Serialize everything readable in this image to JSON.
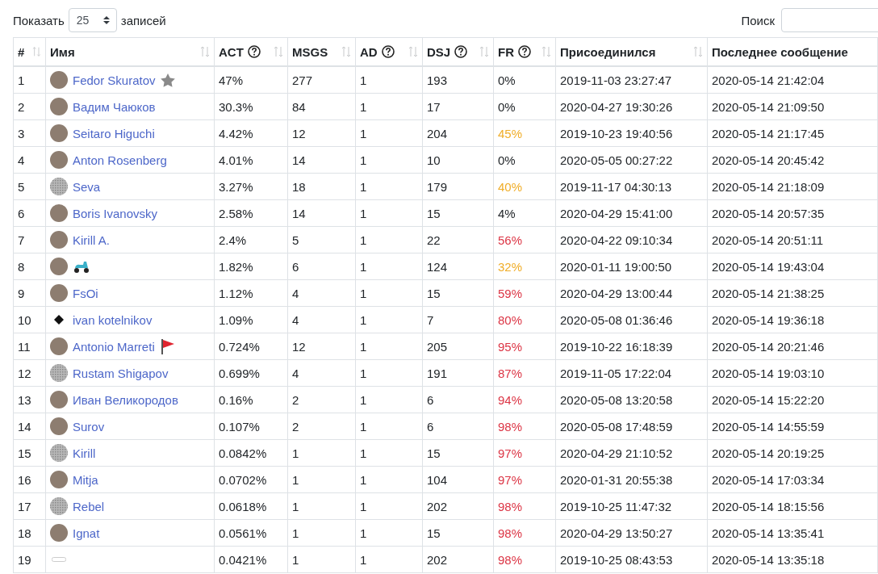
{
  "length_control": {
    "label_before": "Показать",
    "value": "25",
    "label_after": "записей"
  },
  "search": {
    "label": "Поиск"
  },
  "columns": [
    {
      "label": "#",
      "help": false,
      "sortable": true
    },
    {
      "label": "Имя",
      "help": false,
      "sortable": true
    },
    {
      "label": "ACT",
      "help": true,
      "sortable": true
    },
    {
      "label": "MSGS",
      "help": false,
      "sortable": true
    },
    {
      "label": "AD",
      "help": true,
      "sortable": true
    },
    {
      "label": "DSJ",
      "help": true,
      "sortable": true
    },
    {
      "label": "FR",
      "help": true,
      "sortable": true
    },
    {
      "label": "Присоединился",
      "help": false,
      "sortable": true
    },
    {
      "label": "Последнее сообщение",
      "help": false,
      "sortable": false
    }
  ],
  "rows": [
    {
      "num": "1",
      "avatar": {
        "kind": "photo"
      },
      "name": "Fedor Skuratov",
      "badge": {
        "kind": "star"
      },
      "act": "47%",
      "msgs": "277",
      "ad": "1",
      "dsj": "193",
      "fr": "0%",
      "color": "#212529",
      "joined": "2019-11-03 23:27:47",
      "last": "2020-05-14 21:42:04"
    },
    {
      "num": "2",
      "avatar": {
        "kind": "photo"
      },
      "name": "Вадим Чаюков",
      "act": "30.3%",
      "msgs": "84",
      "ad": "1",
      "dsj": "17",
      "fr": "0%",
      "color": "#212529",
      "joined": "2020-04-27 19:30:26",
      "last": "2020-05-14 21:09:50"
    },
    {
      "num": "3",
      "avatar": {
        "kind": "photo"
      },
      "name": "Seitaro Higuchi",
      "act": "4.42%",
      "msgs": "12",
      "ad": "1",
      "dsj": "204",
      "fr": "45%",
      "color": "#f0ad28",
      "joined": "2019-10-23 19:40:56",
      "last": "2020-05-14 21:17:45"
    },
    {
      "num": "4",
      "avatar": {
        "kind": "photo"
      },
      "name": "Anton Rosenberg",
      "act": "4.01%",
      "msgs": "14",
      "ad": "1",
      "dsj": "10",
      "fr": "0%",
      "color": "#212529",
      "joined": "2020-05-05 00:27:22",
      "last": "2020-05-14 20:45:42"
    },
    {
      "num": "5",
      "avatar": {
        "kind": "pattern"
      },
      "name": "Seva",
      "act": "3.27%",
      "msgs": "18",
      "ad": "1",
      "dsj": "179",
      "fr": "40%",
      "color": "#f0ad28",
      "joined": "2019-11-17 04:30:13",
      "last": "2020-05-14 21:18:09"
    },
    {
      "num": "6",
      "avatar": {
        "kind": "photo"
      },
      "name": "Boris Ivanovsky",
      "act": "2.58%",
      "msgs": "14",
      "ad": "1",
      "dsj": "15",
      "fr": "4%",
      "color": "#212529",
      "joined": "2020-04-29 15:41:00",
      "last": "2020-05-14 20:57:35"
    },
    {
      "num": "7",
      "avatar": {
        "kind": "photo"
      },
      "name": "Kirill A.",
      "act": "2.4%",
      "msgs": "5",
      "ad": "1",
      "dsj": "22",
      "fr": "56%",
      "color": "#dc3545",
      "joined": "2020-04-22 09:10:34",
      "last": "2020-05-14 20:51:11"
    },
    {
      "num": "8",
      "avatar": {
        "kind": "photo"
      },
      "badge": {
        "kind": "scooter"
      },
      "act": "1.82%",
      "msgs": "6",
      "ad": "1",
      "dsj": "124",
      "fr": "32%",
      "color": "#f0ad28",
      "joined": "2020-01-11 19:00:50",
      "last": "2020-05-14 19:43:04"
    },
    {
      "num": "9",
      "avatar": {
        "kind": "photo"
      },
      "name": "FsOi",
      "act": "1.12%",
      "msgs": "4",
      "ad": "1",
      "dsj": "15",
      "fr": "59%",
      "color": "#dc3545",
      "joined": "2020-04-29 13:00:44",
      "last": "2020-05-14 21:38:25"
    },
    {
      "num": "10",
      "avatar": {
        "kind": "diamond"
      },
      "name": "ivan kotelnikov",
      "act": "1.09%",
      "msgs": "4",
      "ad": "1",
      "dsj": "7",
      "fr": "80%",
      "color": "#dc3545",
      "joined": "2020-05-08 01:36:46",
      "last": "2020-05-14 19:36:18"
    },
    {
      "num": "11",
      "avatar": {
        "kind": "photo"
      },
      "name": "Antonio Marreti",
      "badge": {
        "kind": "flag"
      },
      "act": "0.724%",
      "msgs": "12",
      "ad": "1",
      "dsj": "205",
      "fr": "95%",
      "color": "#dc3545",
      "joined": "2019-10-22 16:18:39",
      "last": "2020-05-14 20:21:46"
    },
    {
      "num": "12",
      "avatar": {
        "kind": "pattern"
      },
      "name": "Rustam Shigapov",
      "act": "0.699%",
      "msgs": "4",
      "ad": "1",
      "dsj": "191",
      "fr": "87%",
      "color": "#dc3545",
      "joined": "2019-11-05 17:22:04",
      "last": "2020-05-14 19:03:10"
    },
    {
      "num": "13",
      "avatar": {
        "kind": "photo"
      },
      "name": "Иван Великородов",
      "act": "0.16%",
      "msgs": "2",
      "ad": "1",
      "dsj": "6",
      "fr": "94%",
      "color": "#dc3545",
      "joined": "2020-05-08 13:20:58",
      "last": "2020-05-14 15:22:20"
    },
    {
      "num": "14",
      "avatar": {
        "kind": "photo"
      },
      "name": "Surov",
      "act": "0.107%",
      "msgs": "2",
      "ad": "1",
      "dsj": "6",
      "fr": "98%",
      "color": "#dc3545",
      "joined": "2020-05-08 17:48:59",
      "last": "2020-05-14 14:55:59"
    },
    {
      "num": "15",
      "avatar": {
        "kind": "pattern"
      },
      "name": "Kirill",
      "act": "0.0842%",
      "msgs": "1",
      "ad": "1",
      "dsj": "15",
      "fr": "97%",
      "color": "#dc3545",
      "joined": "2020-04-29 21:10:52",
      "last": "2020-05-14 20:19:25"
    },
    {
      "num": "16",
      "avatar": {
        "kind": "photo"
      },
      "name": "Mitja",
      "act": "0.0702%",
      "msgs": "1",
      "ad": "1",
      "dsj": "104",
      "fr": "97%",
      "color": "#dc3545",
      "joined": "2020-01-31 20:55:38",
      "last": "2020-05-14 17:03:34"
    },
    {
      "num": "17",
      "avatar": {
        "kind": "pattern"
      },
      "name": "Rebel",
      "act": "0.0618%",
      "msgs": "1",
      "ad": "1",
      "dsj": "202",
      "fr": "98%",
      "color": "#dc3545",
      "joined": "2019-10-25 11:47:32",
      "last": "2020-05-14 18:15:56"
    },
    {
      "num": "18",
      "avatar": {
        "kind": "photo"
      },
      "name": "Ignat",
      "act": "0.0561%",
      "msgs": "1",
      "ad": "1",
      "dsj": "15",
      "fr": "98%",
      "color": "#dc3545",
      "joined": "2020-04-29 13:50:27",
      "last": "2020-05-14 13:35:41"
    },
    {
      "num": "19",
      "avatar": {
        "kind": "broken"
      },
      "act": "0.0421%",
      "msgs": "1",
      "ad": "1",
      "dsj": "202",
      "fr": "98%",
      "color": "#dc3545",
      "joined": "2019-10-25 08:43:53",
      "last": "2020-05-14 13:35:18"
    }
  ]
}
